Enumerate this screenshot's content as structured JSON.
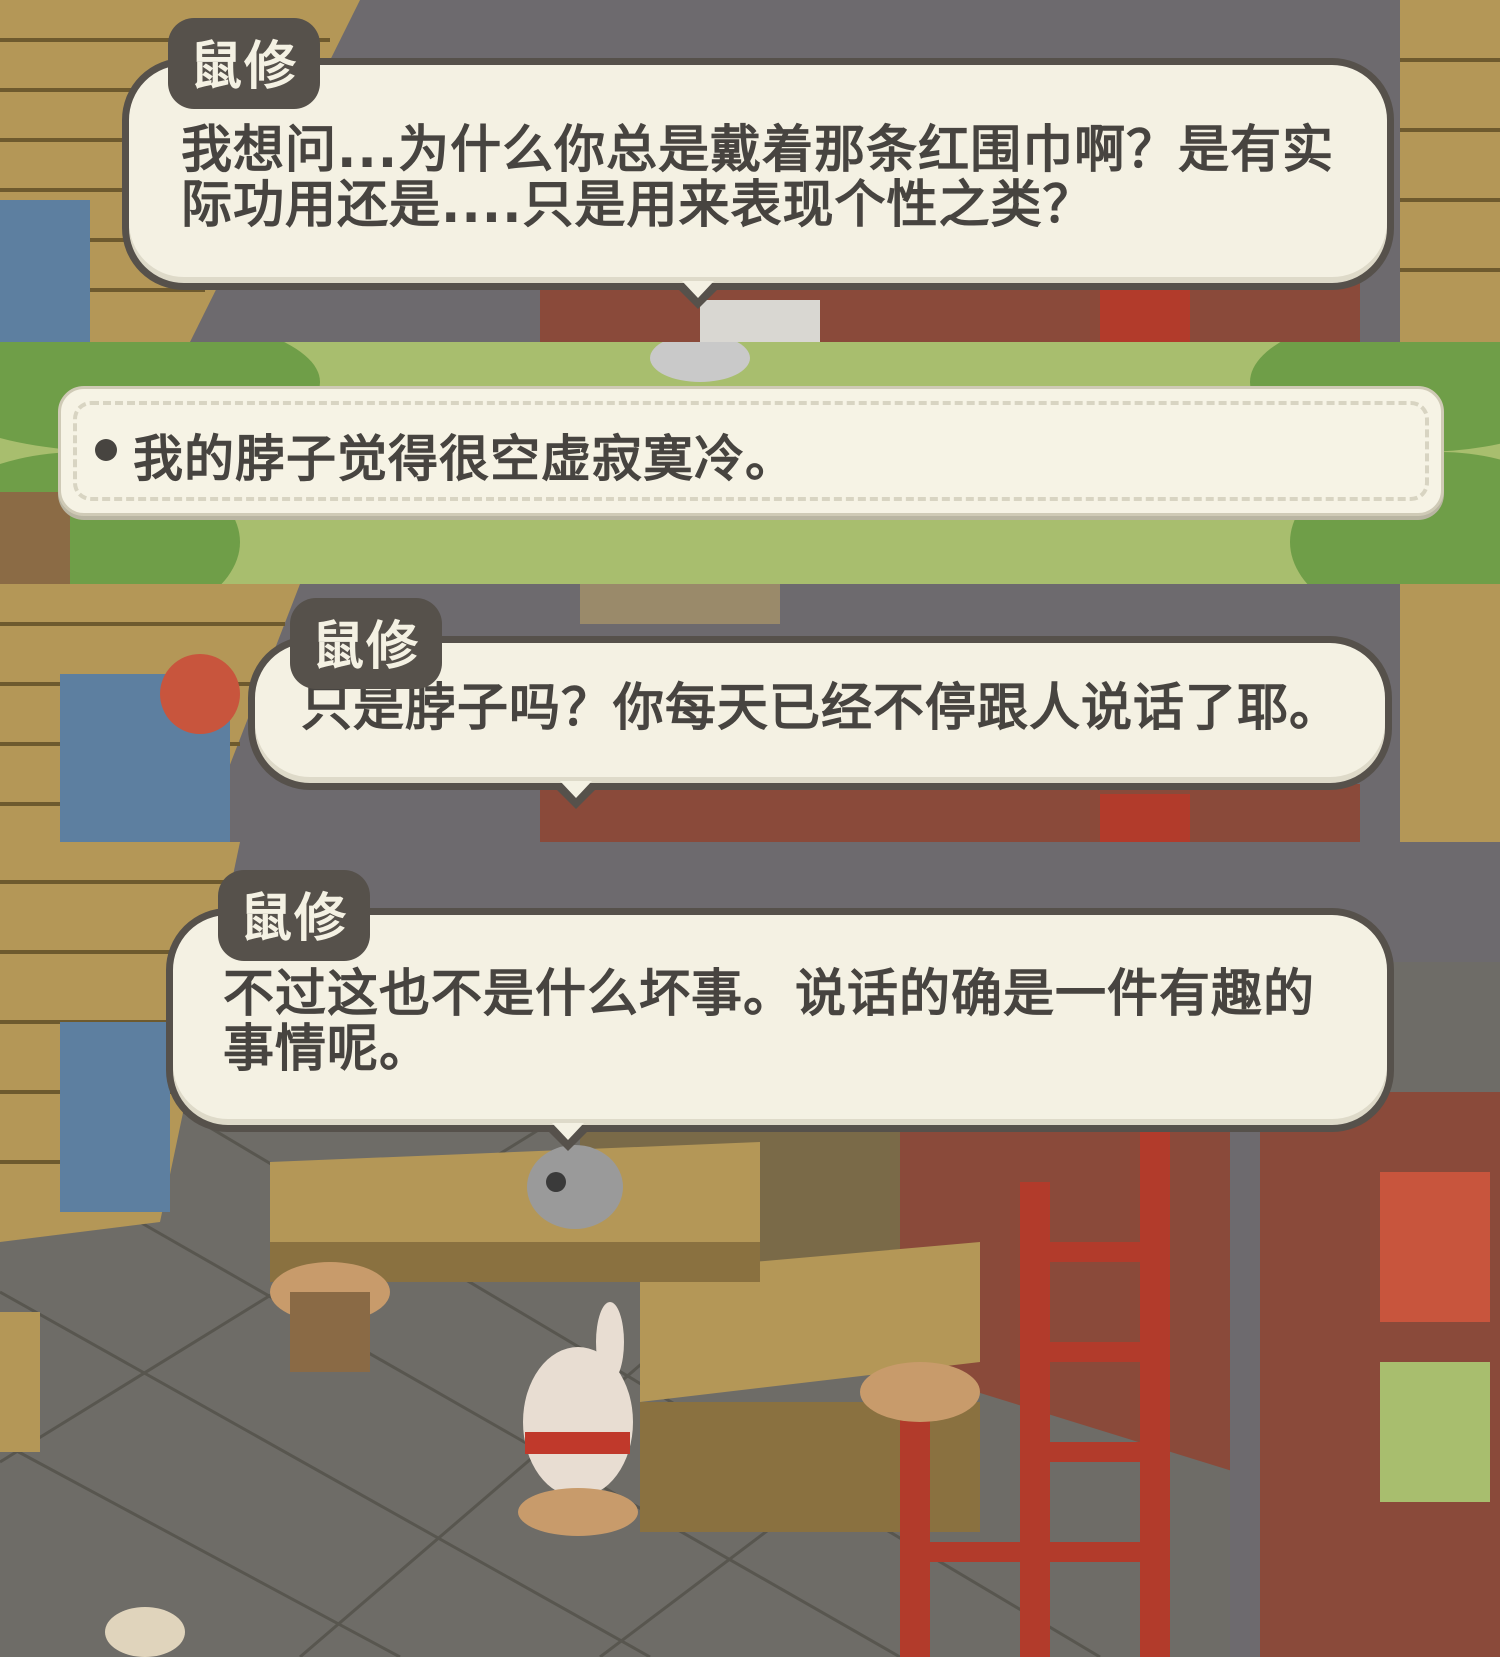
{
  "dialogs": [
    {
      "speaker": "鼠修",
      "lines": [
        "我想问...为什么你总是戴着那条红围巾啊？是有实",
        "际功用还是....只是用来表现个性之类？"
      ]
    },
    {
      "speaker": "鼠修",
      "lines": [
        "只是脖子吗？你每天已经不停跟人说话了耶。"
      ]
    },
    {
      "speaker": "鼠修",
      "lines": [
        "不过这也不是什么坏事。说话的确是一件有趣的",
        "事情呢。"
      ]
    }
  ],
  "choice": {
    "text": "我的脖子觉得很空虚寂寞冷。"
  },
  "colors": {
    "bubble_fill": "#f4f1e3",
    "bubble_border": "#56514b",
    "text": "#474440",
    "grass": "#a8be6e",
    "tree": "#6f9e48",
    "roof": "#6d6a6e",
    "wood": "#b49757",
    "brick": "#8a4a3a",
    "floor": "#6e6c67",
    "lattice_red": "#b23b2b"
  },
  "icons": [
    "bullet-dot-icon",
    "speech-tail-icon"
  ]
}
